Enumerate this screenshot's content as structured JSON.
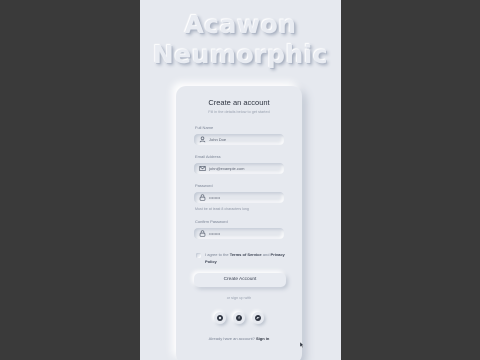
{
  "hero": {
    "line1": "Acawon",
    "line2": "Neumorphic"
  },
  "form": {
    "title": "Create an account",
    "subtitle": "Fill in the details below to get started",
    "full_name": {
      "label": "Full Name",
      "value": "John Doe",
      "icon": "user-icon"
    },
    "email": {
      "label": "Email Address",
      "value": "john@example.com",
      "icon": "mail-icon"
    },
    "password": {
      "label": "Password",
      "value": "••••••••",
      "icon": "lock-icon",
      "hint": "Must be at least 8 characters long"
    },
    "confirm_password": {
      "label": "Confirm Password",
      "value": "••••••••",
      "icon": "lock-icon"
    },
    "terms": {
      "prefix": "I agree to the ",
      "tos": "Terms of Service",
      "and": " and ",
      "privacy": "Privacy Policy"
    },
    "create_button": "Create Account",
    "or_text": "or sign up with",
    "socials": [
      "github-icon",
      "facebook-icon",
      "twitter-icon"
    ],
    "signin": {
      "prompt": "Already have an account? ",
      "link": "Sign in"
    }
  },
  "colors": {
    "background": "#e6e9ef",
    "letterbox": "#3a3a3a",
    "text": "#2e3440"
  }
}
